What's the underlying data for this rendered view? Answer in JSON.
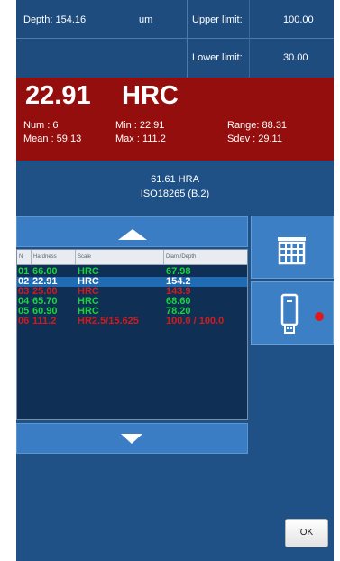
{
  "header": {
    "depth_label": "Depth: 154.16",
    "depth_unit": "um",
    "upper_limit_label": "Upper limit:",
    "upper_limit_value": "100.00",
    "lower_limit_label": "Lower limit:",
    "lower_limit_value": "30.00"
  },
  "result": {
    "value": "22.91",
    "scale": "HRC",
    "num": "Num  : 6",
    "mean": "Mean : 59.13",
    "min": "Min   : 22.91",
    "max": "Max   : 111.2",
    "range": "Range: 88.31",
    "sdev": "Sdev : 29.11",
    "status_color": "#950e0e"
  },
  "conversion": {
    "hra": "61.61 HRA",
    "standard": "ISO18265 (B.2)"
  },
  "table": {
    "columns": [
      "N",
      "Hardness",
      "Scale",
      "Diam./Depth"
    ],
    "rows": [
      {
        "n": "01",
        "hardness": "66.00",
        "scale": "HRC",
        "depth": "67.98",
        "color": "#19d43a",
        "selected": false
      },
      {
        "n": "02",
        "hardness": "22.91",
        "scale": "HRC",
        "depth": "154.2",
        "color": "#ffffff",
        "selected": true
      },
      {
        "n": "03",
        "hardness": "25.00",
        "scale": "HRC",
        "depth": "143.9",
        "color": "#d31a1a",
        "selected": false
      },
      {
        "n": "04",
        "hardness": "65.70",
        "scale": "HRC",
        "depth": "68.60",
        "color": "#19d43a",
        "selected": false
      },
      {
        "n": "05",
        "hardness": "60.90",
        "scale": "HRC",
        "depth": "78.20",
        "color": "#19d43a",
        "selected": false
      },
      {
        "n": "06",
        "hardness": "111.2",
        "scale": "HR2.5/15.625",
        "depth": "100.0 / 100.0",
        "color": "#d31a1a",
        "selected": false
      }
    ]
  },
  "buttons": {
    "ok_label": "OK",
    "delete_icon": "trash-icon",
    "usb_icon": "usb-drive-icon",
    "usb_status_color": "#e0181c"
  }
}
